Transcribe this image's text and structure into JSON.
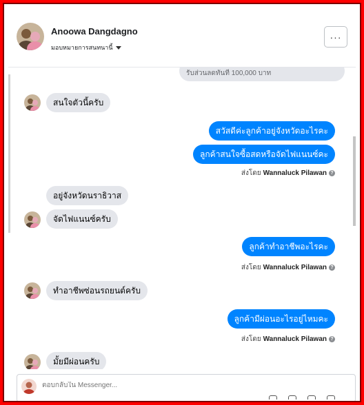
{
  "header": {
    "name": "Anoowa Dangdagno",
    "subtitle": "มอบหมายการสนทนานี้",
    "more_label": "···"
  },
  "thread": {
    "truncated_top": "รับส่วนลดทันที 100,000 บาท",
    "messages": [
      {
        "side": "in",
        "text": "สนใจตัวนี้ครับ"
      },
      {
        "side": "out",
        "text": "สวัสดีค่ะลูกค้าอยู่จังหวัดอะไรคะ"
      },
      {
        "side": "out",
        "text": "ลูกค้าสนใจซื้อสดหรือจัดไฟแนนซ์คะ"
      },
      {
        "side": "in",
        "text": "อยู่จังหวัดนราธิวาส"
      },
      {
        "side": "in",
        "text": "จัดไฟแนนซ์ครับ"
      },
      {
        "side": "out",
        "text": "ลูกค้าทำอาชีพอะไรคะ"
      },
      {
        "side": "in",
        "text": "ทำอาชีพซ่อนรถยนต์ครับ"
      },
      {
        "side": "out",
        "text": "ลูกค้ามีผ่อนอะไรอยู่ไหมคะ"
      },
      {
        "side": "in",
        "text": "มั้ยมีผ่อนครับ"
      }
    ],
    "sent_by_prefix": "ส่งโดย",
    "sent_by_name": "Wannaluck Pilawan",
    "info_symbol": "?"
  },
  "composer": {
    "placeholder": "ตอบกลับใน Messenger..."
  },
  "colors": {
    "frame": "#ff0000",
    "outgoing_bubble": "#0084ff",
    "incoming_bubble": "#e4e6eb"
  },
  "icons": [
    "more-icon",
    "caret-down-icon",
    "info-icon",
    "avatar",
    "composer-avatar"
  ]
}
